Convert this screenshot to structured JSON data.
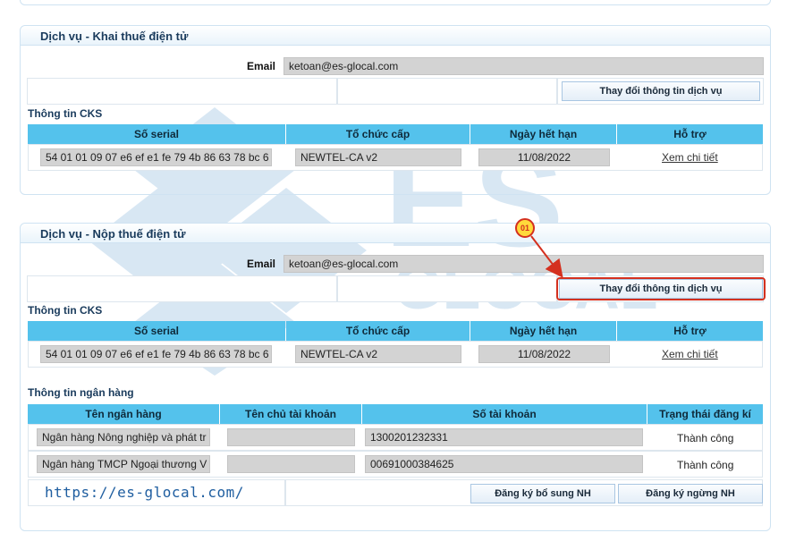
{
  "service1": {
    "title": "Dịch vụ - Khai thuế điện tử",
    "email_label": "Email",
    "email_value": "ketoan@es-glocal.com",
    "change_button": "Thay đổi thông tin dịch vụ",
    "cks_title": "Thông tin CKS",
    "columns": [
      "Số serial",
      "Tổ chức cấp",
      "Ngày hết hạn",
      "Hỗ trợ"
    ],
    "row": {
      "serial": "54 01 01 09 07 e6 ef e1 fe 79 4b 86 63 78 bc 6",
      "issuer": "NEWTEL-CA v2",
      "expiry": "11/08/2022",
      "support_link": "Xem chi tiết"
    }
  },
  "service2": {
    "title": "Dịch vụ - Nộp thuế điện tử",
    "email_label": "Email",
    "email_value": "ketoan@es-glocal.com",
    "change_button": "Thay đổi thông tin dịch vụ",
    "cks_title": "Thông tin CKS",
    "columns": [
      "Số serial",
      "Tổ chức cấp",
      "Ngày hết hạn",
      "Hỗ trợ"
    ],
    "row": {
      "serial": "54 01 01 09 07 e6 ef e1 fe 79 4b 86 63 78 bc 6",
      "issuer": "NEWTEL-CA v2",
      "expiry": "11/08/2022",
      "support_link": "Xem chi tiết"
    },
    "bank_title": "Thông tin ngân hàng",
    "bank_columns": [
      "Tên ngân hàng",
      "Tên chủ tài khoản",
      "Số tài khoản",
      "Trạng thái đăng kí"
    ],
    "bank_rows": [
      {
        "bank": "Ngân hàng Nông nghiệp và phát tr",
        "owner": "",
        "account": "1300201232331",
        "status": "Thành công"
      },
      {
        "bank": "Ngân hàng TMCP Ngoại thương V",
        "owner": "",
        "account": "00691000384625",
        "status": "Thành công"
      }
    ],
    "add_bank_button": "Đăng ký bổ sung NH",
    "stop_bank_button": "Đăng ký ngừng NH"
  },
  "annotation": {
    "step_label": "01",
    "color": "#d4301f"
  },
  "watermark": {
    "text_top": "ES",
    "text_bottom": "GLOCAL",
    "url": "https://es-glocal.com/"
  }
}
